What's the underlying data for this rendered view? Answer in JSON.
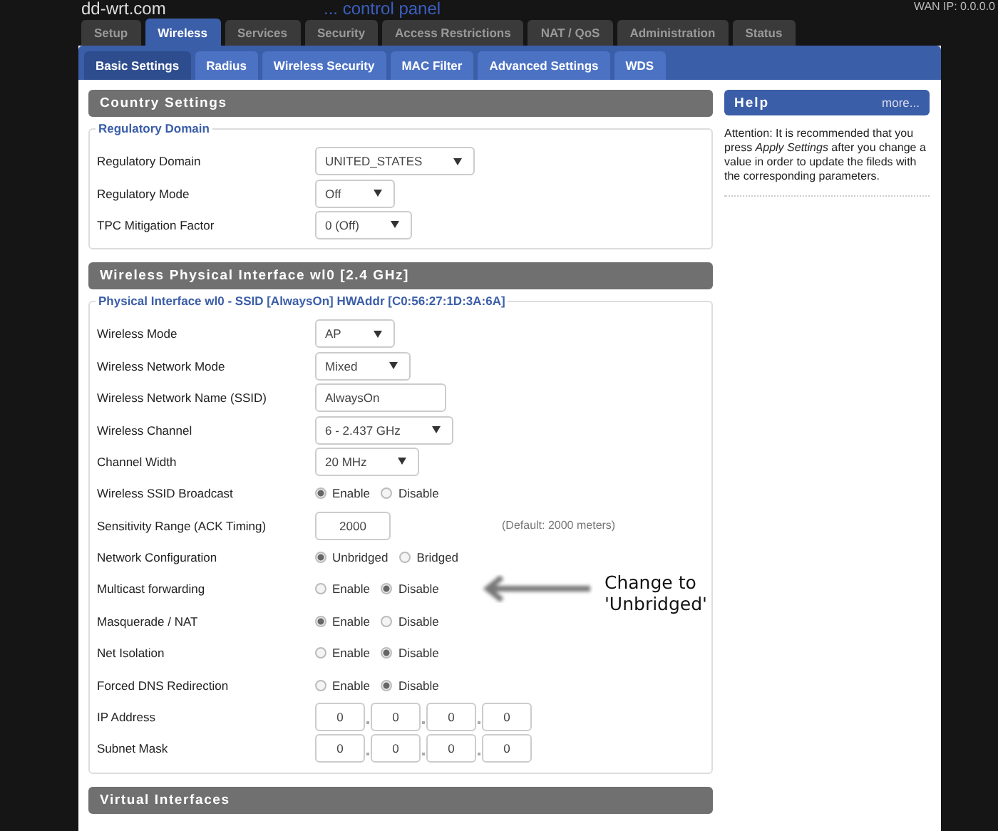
{
  "header": {
    "logo": "dd-wrt.com",
    "tagline": "... control panel",
    "wan_ip": "WAN IP: 0.0.0.0"
  },
  "tabs": [
    {
      "label": "Setup",
      "selected": false
    },
    {
      "label": "Wireless",
      "selected": true
    },
    {
      "label": "Services",
      "selected": false
    },
    {
      "label": "Security",
      "selected": false
    },
    {
      "label": "Access Restrictions",
      "selected": false
    },
    {
      "label": "NAT / QoS",
      "selected": false
    },
    {
      "label": "Administration",
      "selected": false
    },
    {
      "label": "Status",
      "selected": false
    }
  ],
  "subtabs": [
    {
      "label": "Basic Settings",
      "selected": true
    },
    {
      "label": "Radius",
      "selected": false
    },
    {
      "label": "Wireless Security",
      "selected": false
    },
    {
      "label": "MAC Filter",
      "selected": false
    },
    {
      "label": "Advanced Settings",
      "selected": false
    },
    {
      "label": "WDS",
      "selected": false
    }
  ],
  "sections": [
    {
      "title": "Country Settings",
      "legend": "Regulatory Domain",
      "rows": [
        {
          "label": "Regulatory Domain",
          "kind": "select",
          "value": "UNITED_STATES"
        },
        {
          "label": "Regulatory Mode",
          "kind": "select",
          "value": "Off"
        },
        {
          "label": "TPC Mitigation Factor",
          "kind": "select",
          "value": "0 (Off)"
        }
      ]
    },
    {
      "title": "Wireless Physical Interface wl0 [2.4 GHz]",
      "legend": "Physical Interface wl0 - SSID [AlwaysOn] HWAddr [C0:56:27:1D:3A:6A]",
      "rows": [
        {
          "label": "Wireless Mode",
          "kind": "select",
          "value": "AP"
        },
        {
          "label": "Wireless Network Mode",
          "kind": "select",
          "value": "Mixed"
        },
        {
          "label": "Wireless Network Name (SSID)",
          "kind": "text",
          "value": "AlwaysOn"
        },
        {
          "label": "Wireless Channel",
          "kind": "select",
          "value": "6 - 2.437 GHz"
        },
        {
          "label": "Channel Width",
          "kind": "select",
          "value": "20 MHz"
        },
        {
          "label": "Wireless SSID Broadcast",
          "kind": "radio",
          "options": [
            {
              "label": "Enable",
              "selected": true
            },
            {
              "label": "Disable",
              "selected": false
            }
          ]
        },
        {
          "label": "Sensitivity Range (ACK Timing)",
          "kind": "number",
          "value": "2000",
          "note": "(Default: 2000 meters)"
        },
        {
          "label": "Network Configuration",
          "kind": "radio",
          "options": [
            {
              "label": "Unbridged",
              "selected": true
            },
            {
              "label": "Bridged",
              "selected": false
            }
          ]
        },
        {
          "label": "Multicast forwarding",
          "kind": "radio",
          "options": [
            {
              "label": "Enable",
              "selected": false
            },
            {
              "label": "Disable",
              "selected": true
            }
          ]
        },
        {
          "label": "Masquerade / NAT",
          "kind": "radio",
          "options": [
            {
              "label": "Enable",
              "selected": true
            },
            {
              "label": "Disable",
              "selected": false
            }
          ]
        },
        {
          "label": "Net Isolation",
          "kind": "radio",
          "options": [
            {
              "label": "Enable",
              "selected": false
            },
            {
              "label": "Disable",
              "selected": true
            }
          ]
        },
        {
          "label": "Forced DNS Redirection",
          "kind": "radio",
          "options": [
            {
              "label": "Enable",
              "selected": false
            },
            {
              "label": "Disable",
              "selected": true
            }
          ]
        },
        {
          "label": "IP Address",
          "kind": "ip",
          "octets": [
            "0",
            "0",
            "0",
            "0"
          ]
        },
        {
          "label": "Subnet Mask",
          "kind": "ip",
          "octets": [
            "0",
            "0",
            "0",
            "0"
          ]
        }
      ]
    },
    {
      "title": "Virtual Interfaces"
    }
  ],
  "help": {
    "title": "Help",
    "link": "more...",
    "text": "Attention: It is recommended that you press *Apply Settings* after you change a value in order to update the fileds with the corresponding parameters."
  },
  "annotation": "Change to 'Unbridged'"
}
